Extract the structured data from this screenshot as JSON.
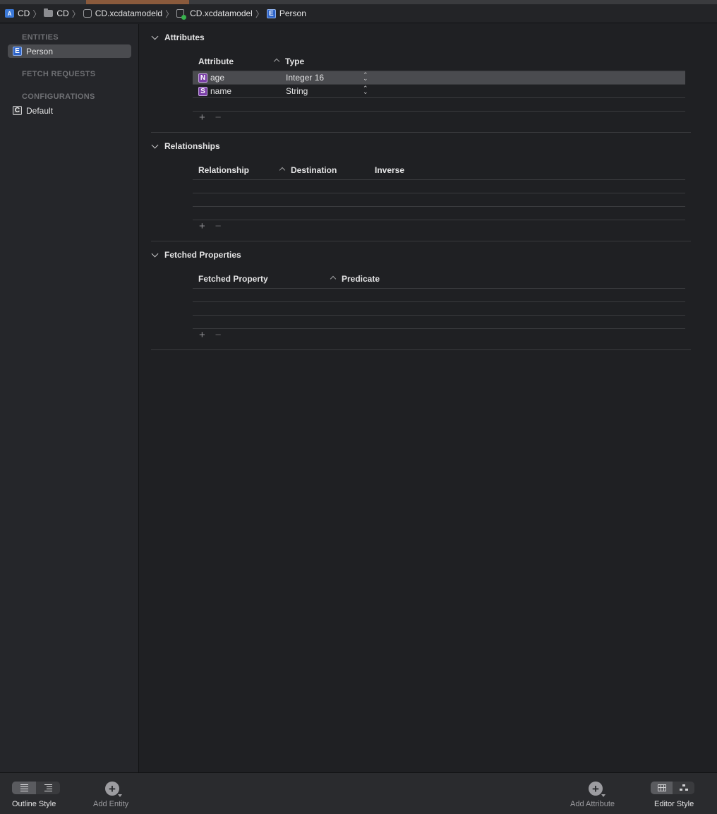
{
  "breadcrumb": {
    "items": [
      {
        "label": "CD",
        "icon": "app-icon"
      },
      {
        "label": "CD",
        "icon": "folder-icon"
      },
      {
        "label": "CD.xcdatamodeld",
        "icon": "datamodel-bundle-icon"
      },
      {
        "label": "CD.xcdatamodel",
        "icon": "datamodel-icon"
      },
      {
        "label": "Person",
        "icon": "entity-icon",
        "badge": "E"
      }
    ]
  },
  "sidebar": {
    "entities_header": "ENTITIES",
    "entities": [
      {
        "label": "Person",
        "badge": "E",
        "selected": true
      }
    ],
    "fetch_requests_header": "FETCH REQUESTS",
    "configurations_header": "CONFIGURATIONS",
    "configurations": [
      {
        "label": "Default",
        "badge": "C"
      }
    ]
  },
  "attributes": {
    "title": "Attributes",
    "columns": [
      "Attribute",
      "Type"
    ],
    "rows": [
      {
        "badge": "N",
        "name": "age",
        "type": "Integer 16",
        "selected": true
      },
      {
        "badge": "S",
        "name": "name",
        "type": "String",
        "selected": false
      }
    ],
    "add": "+",
    "remove": "−"
  },
  "relationships": {
    "title": "Relationships",
    "columns": [
      "Relationship",
      "Destination",
      "Inverse"
    ],
    "add": "+",
    "remove": "−"
  },
  "fetched_properties": {
    "title": "Fetched Properties",
    "columns": [
      "Fetched Property",
      "Predicate"
    ],
    "add": "+",
    "remove": "−"
  },
  "bottombar": {
    "outline_style": "Outline Style",
    "add_entity": "Add Entity",
    "add_attribute": "Add Attribute",
    "editor_style": "Editor Style",
    "plus": "+"
  }
}
